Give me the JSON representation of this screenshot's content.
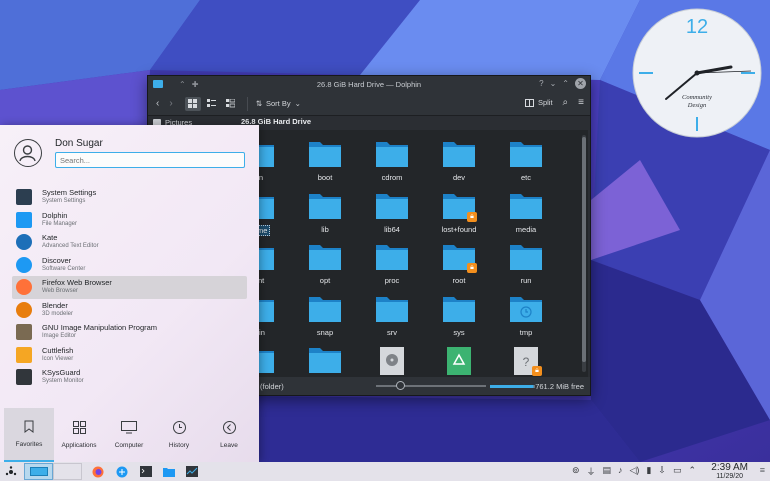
{
  "desktop": {
    "clock_widget": {
      "hour_mark": "12",
      "caption_line1": "Community",
      "caption_line2": "Design"
    }
  },
  "dolphin": {
    "title": "26.8 GiB Hard Drive — Dolphin",
    "titlebar_controls": [
      "?",
      "⌄",
      "⌃",
      "✕"
    ],
    "toolbar": {
      "sort_label": "Sort By",
      "split_label": "Split"
    },
    "places": {
      "visible_item": "Pictures"
    },
    "location_title": "26.8 GiB Hard Drive",
    "folders": [
      {
        "name": "bin",
        "locked": false
      },
      {
        "name": "boot",
        "locked": false
      },
      {
        "name": "cdrom",
        "locked": false
      },
      {
        "name": "dev",
        "locked": false
      },
      {
        "name": "etc",
        "locked": false
      },
      {
        "name": "home",
        "locked": false,
        "selected": true
      },
      {
        "name": "lib",
        "locked": false
      },
      {
        "name": "lib64",
        "locked": false
      },
      {
        "name": "lost+found",
        "locked": true
      },
      {
        "name": "media",
        "locked": false
      },
      {
        "name": "mnt",
        "locked": false
      },
      {
        "name": "opt",
        "locked": false
      },
      {
        "name": "proc",
        "locked": false
      },
      {
        "name": "root",
        "locked": true
      },
      {
        "name": "run",
        "locked": false
      },
      {
        "name": "sbin",
        "locked": false
      },
      {
        "name": "snap",
        "locked": false
      },
      {
        "name": "srv",
        "locked": false
      },
      {
        "name": "sys",
        "locked": false
      },
      {
        "name": "tmp",
        "locked": false
      }
    ],
    "status": {
      "selection": "(folder)",
      "free_space": "761.2 MiB free",
      "space_used_fraction": 0.97
    }
  },
  "launcher": {
    "user_name": "Don Sugar",
    "search_placeholder": "Search...",
    "apps": [
      {
        "name": "System Settings",
        "desc": "System Settings",
        "icon": "system-settings-icon"
      },
      {
        "name": "Dolphin",
        "desc": "File Manager",
        "icon": "dolphin-icon"
      },
      {
        "name": "Kate",
        "desc": "Advanced Text Editor",
        "icon": "kate-icon"
      },
      {
        "name": "Discover",
        "desc": "Software Center",
        "icon": "discover-icon"
      },
      {
        "name": "Firefox Web Browser",
        "desc": "Web Browser",
        "icon": "firefox-icon"
      },
      {
        "name": "Blender",
        "desc": "3D modeler",
        "icon": "blender-icon"
      },
      {
        "name": "GNU Image Manipulation Program",
        "desc": "Image Editor",
        "icon": "gimp-icon"
      },
      {
        "name": "Cuttlefish",
        "desc": "Icon Viewer",
        "icon": "cuttlefish-icon"
      },
      {
        "name": "KSysGuard",
        "desc": "System Monitor",
        "icon": "ksysguard-icon"
      }
    ],
    "tabs": [
      "Favorites",
      "Applications",
      "Computer",
      "History",
      "Leave"
    ]
  },
  "taskbar": {
    "time": "2:39 AM",
    "date": "11/29/20"
  },
  "colors": {
    "accent": "#3daee9",
    "folder": "#3daee9",
    "lock_badge": "#f38f1d"
  }
}
